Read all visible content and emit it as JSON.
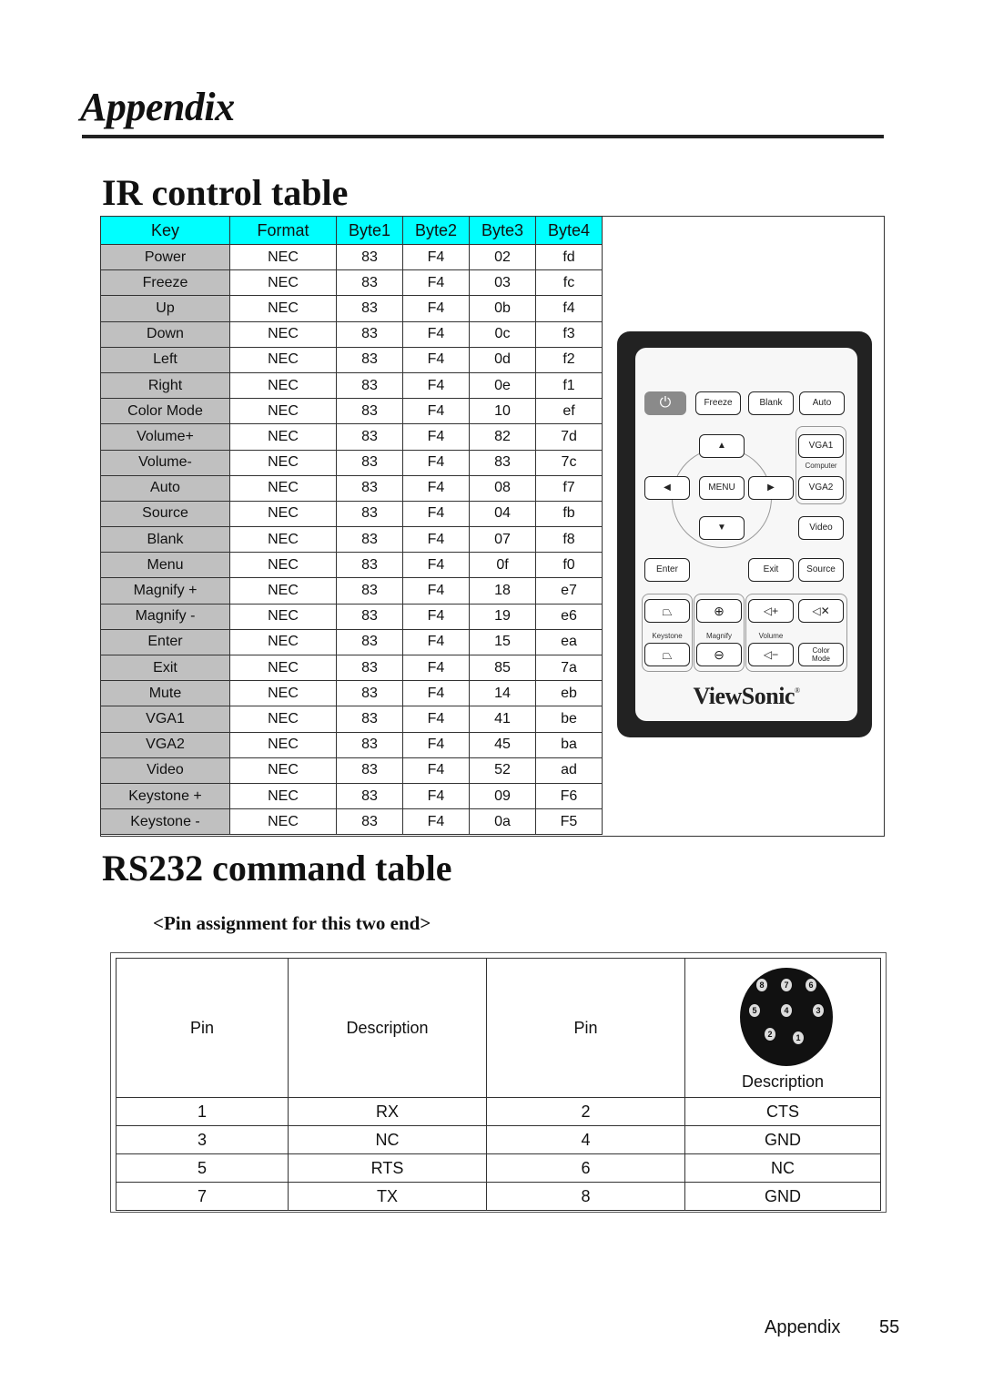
{
  "chapter_title": "Appendix",
  "ir_section": {
    "title": "IR control table",
    "columns": [
      "Key",
      "Format",
      "Byte1",
      "Byte2",
      "Byte3",
      "Byte4"
    ],
    "rows": [
      [
        "Power",
        "NEC",
        "83",
        "F4",
        "02",
        "fd"
      ],
      [
        "Freeze",
        "NEC",
        "83",
        "F4",
        "03",
        "fc"
      ],
      [
        "Up",
        "NEC",
        "83",
        "F4",
        "0b",
        "f4"
      ],
      [
        "Down",
        "NEC",
        "83",
        "F4",
        "0c",
        "f3"
      ],
      [
        "Left",
        "NEC",
        "83",
        "F4",
        "0d",
        "f2"
      ],
      [
        "Right",
        "NEC",
        "83",
        "F4",
        "0e",
        "f1"
      ],
      [
        "Color Mode",
        "NEC",
        "83",
        "F4",
        "10",
        "ef"
      ],
      [
        "Volume+",
        "NEC",
        "83",
        "F4",
        "82",
        "7d"
      ],
      [
        "Volume-",
        "NEC",
        "83",
        "F4",
        "83",
        "7c"
      ],
      [
        "Auto",
        "NEC",
        "83",
        "F4",
        "08",
        "f7"
      ],
      [
        "Source",
        "NEC",
        "83",
        "F4",
        "04",
        "fb"
      ],
      [
        "Blank",
        "NEC",
        "83",
        "F4",
        "07",
        "f8"
      ],
      [
        "Menu",
        "NEC",
        "83",
        "F4",
        "0f",
        "f0"
      ],
      [
        "Magnify +",
        "NEC",
        "83",
        "F4",
        "18",
        "e7"
      ],
      [
        "Magnify -",
        "NEC",
        "83",
        "F4",
        "19",
        "e6"
      ],
      [
        "Enter",
        "NEC",
        "83",
        "F4",
        "15",
        "ea"
      ],
      [
        "Exit",
        "NEC",
        "83",
        "F4",
        "85",
        "7a"
      ],
      [
        "Mute",
        "NEC",
        "83",
        "F4",
        "14",
        "eb"
      ],
      [
        "VGA1",
        "NEC",
        "83",
        "F4",
        "41",
        "be"
      ],
      [
        "VGA2",
        "NEC",
        "83",
        "F4",
        "45",
        "ba"
      ],
      [
        "Video",
        "NEC",
        "83",
        "F4",
        "52",
        "ad"
      ],
      [
        "Keystone +",
        "NEC",
        "83",
        "F4",
        "09",
        "F6"
      ],
      [
        "Keystone -",
        "NEC",
        "83",
        "F4",
        "0a",
        "F5"
      ]
    ],
    "header_color": "#00ffff",
    "key_column_color": "#c0c0c0"
  },
  "remote": {
    "power_icon": "power-icon",
    "freeze": "Freeze",
    "blank": "Blank",
    "auto": "Auto",
    "vga1": "VGA1",
    "computer": "Computer",
    "vga2": "VGA2",
    "up_icon": "▲",
    "down_icon": "▼",
    "left_icon": "◀",
    "right_icon": "▶",
    "menu": "MENU",
    "video": "Video",
    "enter": "Enter",
    "exit": "Exit",
    "source": "Source",
    "keystone": "Keystone",
    "magnify": "Magnify",
    "volume": "Volume",
    "magnify_in_icon": "⊕",
    "magnify_out_icon": "⊖",
    "volume_up": "◁+",
    "volume_down": "◁−",
    "mute_icon": "🔇",
    "color_mode_line1": "Color",
    "color_mode_line2": "Mode",
    "brand": "ViewSonic",
    "brand_mark": "®"
  },
  "rs232_section": {
    "title": "RS232 command table",
    "subheading": "<Pin assignment for this two end>",
    "header": [
      "Pin",
      "Description",
      "Pin",
      "Description"
    ],
    "rows": [
      [
        "1",
        "RX",
        "2",
        "CTS"
      ],
      [
        "3",
        "NC",
        "4",
        "GND"
      ],
      [
        "5",
        "RTS",
        "6",
        "NC"
      ],
      [
        "7",
        "TX",
        "8",
        "GND"
      ]
    ],
    "connector_pins": [
      "8",
      "7",
      "6",
      "5",
      "4",
      "3",
      "2",
      "1"
    ]
  },
  "footer": {
    "section": "Appendix",
    "page": "55"
  }
}
